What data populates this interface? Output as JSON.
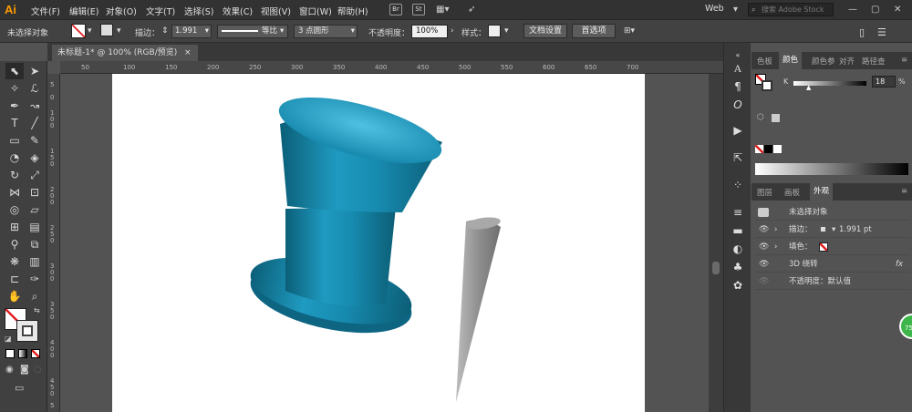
{
  "app": {
    "logo": "Ai"
  },
  "menu": [
    "文件(F)",
    "编辑(E)",
    "对象(O)",
    "文字(T)",
    "选择(S)",
    "效果(C)",
    "视图(V)",
    "窗口(W)",
    "帮助(H)"
  ],
  "bridge": {
    "br": "Br",
    "st": "St"
  },
  "workspace": {
    "label": "Web",
    "search_placeholder": "搜索 Adobe Stock"
  },
  "control": {
    "no_selection": "未选择对象",
    "stroke_label": "描边：",
    "stroke_value": "1.991",
    "profile_label": "等比",
    "brush_label": "3 点圆形",
    "opacity_label": "不透明度：",
    "opacity_value": "100%",
    "style_label": "样式：",
    "doc_setup": "文档设置",
    "preferences": "首选项"
  },
  "document": {
    "tab_title": "未标题-1* @ 100% (RGB/预览)",
    "close": "×"
  },
  "ruler": {
    "h": [
      "50",
      "100",
      "150",
      "200",
      "250",
      "300",
      "350",
      "400",
      "450",
      "500",
      "550",
      "600",
      "650",
      "700"
    ],
    "v": [
      "5",
      "0",
      "1 0 0",
      "1 5 0",
      "2 0 0",
      "2 5 0",
      "3 0 0",
      "3 5 0",
      "4 0 0",
      "4 5 0",
      "5"
    ]
  },
  "color_panel": {
    "tabs": [
      "色板",
      "颜色",
      "颜色参",
      "对齐",
      "路径查"
    ],
    "active": "颜色",
    "channel": "K",
    "value": "18",
    "unit": "%"
  },
  "appearance_panel": {
    "tabs": [
      "图层",
      "画板",
      "外观"
    ],
    "active": "外观",
    "title": "未选择对象",
    "rows": [
      {
        "label": "描边：",
        "value": "1.991 pt"
      },
      {
        "label": "填色：",
        "value": ""
      },
      {
        "label": "3D 绕转",
        "value": "fx"
      },
      {
        "label": "不透明度：默认值",
        "value": ""
      }
    ]
  },
  "badge": {
    "text": "75"
  },
  "colors": {
    "teal": "#1b8bab",
    "cone": "#9a9a9a",
    "accent": "#ff9a00"
  }
}
